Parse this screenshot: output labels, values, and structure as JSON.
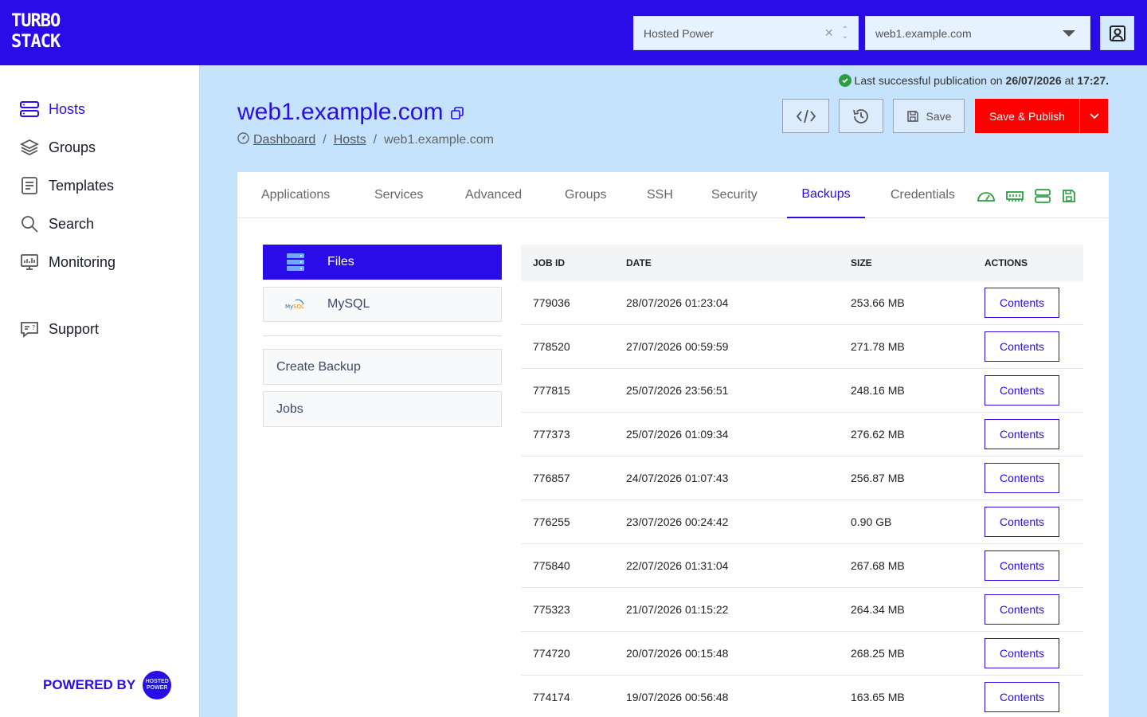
{
  "brand": {
    "logo_line1": "TURBO",
    "logo_line2": "STACK",
    "accent": "#2a0ce8",
    "publish_color": "#ff0000"
  },
  "topbar": {
    "org_select": {
      "value": "Hosted Power"
    },
    "host_select": {
      "value": "web1.example.com"
    }
  },
  "sidebar": {
    "items": [
      {
        "label": "Hosts",
        "icon": "hosts-icon"
      },
      {
        "label": "Groups",
        "icon": "layers-icon"
      },
      {
        "label": "Templates",
        "icon": "document-icon"
      },
      {
        "label": "Search",
        "icon": "search-icon"
      },
      {
        "label": "Monitoring",
        "icon": "monitor-icon"
      },
      {
        "label": "Support",
        "icon": "support-icon"
      }
    ],
    "powered_by": "POWERED BY",
    "powered_logo": "HOSTED POWER"
  },
  "header": {
    "last_publication_prefix": "Last successful publication on",
    "last_publication_date": "26/07/2026",
    "last_publication_at": "at",
    "last_publication_time": "17:27.",
    "title": "web1.example.com",
    "breadcrumb": {
      "dashboard": "Dashboard",
      "hosts": "Hosts",
      "current": "web1.example.com"
    },
    "save_label": "Save",
    "publish_label": "Save & Publish"
  },
  "tabs": [
    "Applications",
    "Services",
    "Advanced",
    "Groups",
    "SSH",
    "Security",
    "Backups",
    "Credentials"
  ],
  "backup": {
    "types": [
      {
        "label": "Files"
      },
      {
        "label": "MySQL"
      }
    ],
    "actions": [
      {
        "label": "Create Backup"
      },
      {
        "label": "Jobs"
      }
    ],
    "columns": [
      "JOB ID",
      "DATE",
      "SIZE",
      "ACTIONS"
    ],
    "rows": [
      {
        "id": "779036",
        "date": "28/07/2026 01:23:04",
        "size": "253.66 MB",
        "action": "Contents"
      },
      {
        "id": "778520",
        "date": "27/07/2026 00:59:59",
        "size": "271.78 MB",
        "action": "Contents"
      },
      {
        "id": "777815",
        "date": "25/07/2026 23:56:51",
        "size": "248.16 MB",
        "action": "Contents"
      },
      {
        "id": "777373",
        "date": "25/07/2026 01:09:34",
        "size": "276.62 MB",
        "action": "Contents"
      },
      {
        "id": "776857",
        "date": "24/07/2026 01:07:43",
        "size": "256.87 MB",
        "action": "Contents"
      },
      {
        "id": "776255",
        "date": "23/07/2026 00:24:42",
        "size": "0.90 GB",
        "action": "Contents"
      },
      {
        "id": "775840",
        "date": "22/07/2026 01:31:04",
        "size": "267.68 MB",
        "action": "Contents"
      },
      {
        "id": "775323",
        "date": "21/07/2026 01:15:22",
        "size": "264.34 MB",
        "action": "Contents"
      },
      {
        "id": "774720",
        "date": "20/07/2026 00:15:48",
        "size": "268.25 MB",
        "action": "Contents"
      },
      {
        "id": "774174",
        "date": "19/07/2026 00:56:48",
        "size": "163.65 MB",
        "action": "Contents"
      }
    ]
  }
}
